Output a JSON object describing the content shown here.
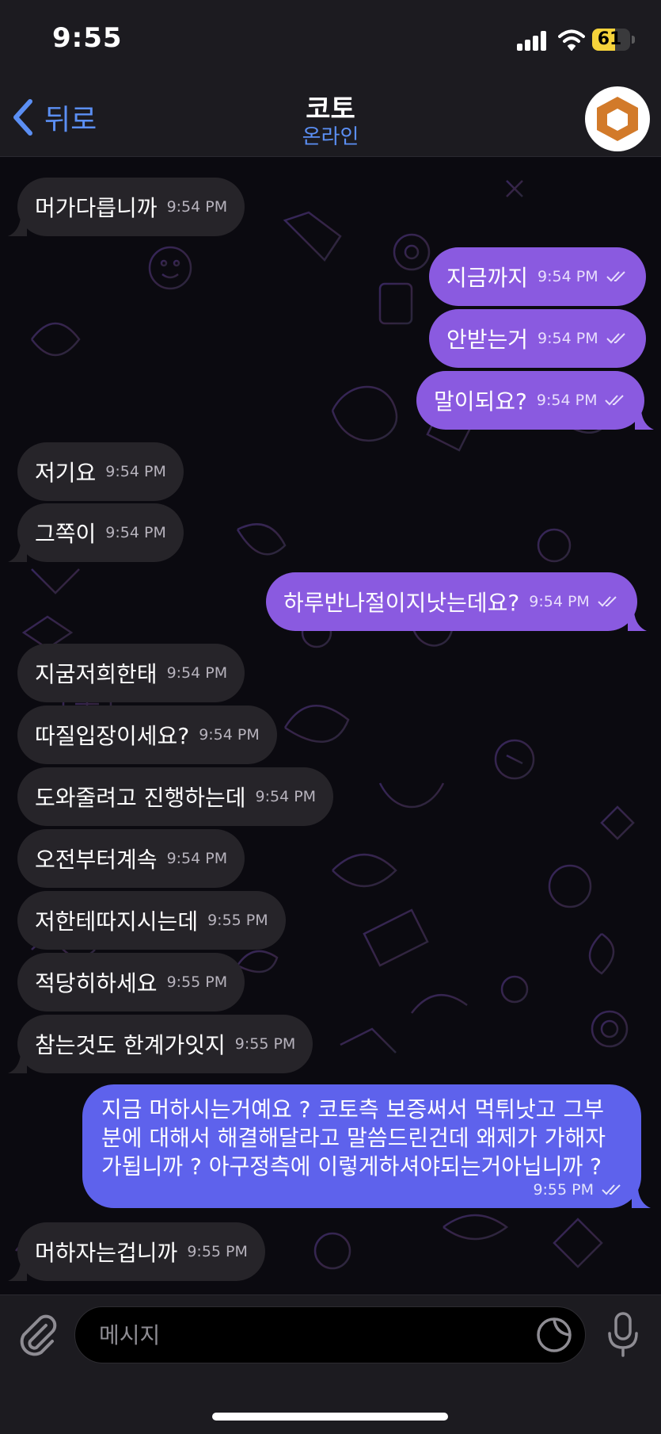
{
  "status_bar": {
    "time": "9:55",
    "battery": "61",
    "battery_level": 0.61
  },
  "header": {
    "back_label": "뒤로",
    "title": "코토",
    "status": "온라인",
    "avatar_color": "#d27a2a"
  },
  "messages": [
    {
      "direction": "in",
      "text": "머가다릅니까",
      "time": "9:54 PM"
    },
    {
      "direction": "out",
      "text": "지금까지",
      "time": "9:54 PM",
      "read": true
    },
    {
      "direction": "out",
      "text": "안받는거",
      "time": "9:54 PM",
      "read": true
    },
    {
      "direction": "out",
      "text": "말이되요?",
      "time": "9:54 PM",
      "read": true
    },
    {
      "direction": "in",
      "text": "저기요",
      "time": "9:54 PM"
    },
    {
      "direction": "in",
      "text": "그쪽이",
      "time": "9:54 PM"
    },
    {
      "direction": "out",
      "text": "하루반나절이지낫는데요?",
      "time": "9:54 PM",
      "read": true
    },
    {
      "direction": "in",
      "text": "지굼저희한태",
      "time": "9:54 PM"
    },
    {
      "direction": "in",
      "text": "따질입장이세요?",
      "time": "9:54 PM"
    },
    {
      "direction": "in",
      "text": "도와줄려고 진행하는데",
      "time": "9:54 PM"
    },
    {
      "direction": "in",
      "text": "오전부터계속",
      "time": "9:54 PM"
    },
    {
      "direction": "in",
      "text": "저한테따지시는데",
      "time": "9:55 PM"
    },
    {
      "direction": "in",
      "text": "적당히하세요",
      "time": "9:55 PM"
    },
    {
      "direction": "in",
      "text": "참는것도 한계가잇지",
      "time": "9:55 PM"
    },
    {
      "direction": "out",
      "text": "지금 머하시는거예요 ? 코토측 보증써서 먹튀낫고 그부\n분에 대해서 해결해달라고 말씀드린건데 왜제가 가해자\n가됩니까 ? 아구정측에 이렇게하셔야되는거아닙니까 ?",
      "time": "9:55 PM",
      "read": true
    },
    {
      "direction": "in",
      "text": "머하자는겁니까",
      "time": "9:55 PM"
    }
  ],
  "input": {
    "placeholder": "메시지"
  },
  "colors": {
    "incoming_bubble": "#262429",
    "outgoing_bubble": "#8a5ae0",
    "outgoing_long_bubble": "#5e62ec",
    "accent": "#5b8ff4"
  }
}
